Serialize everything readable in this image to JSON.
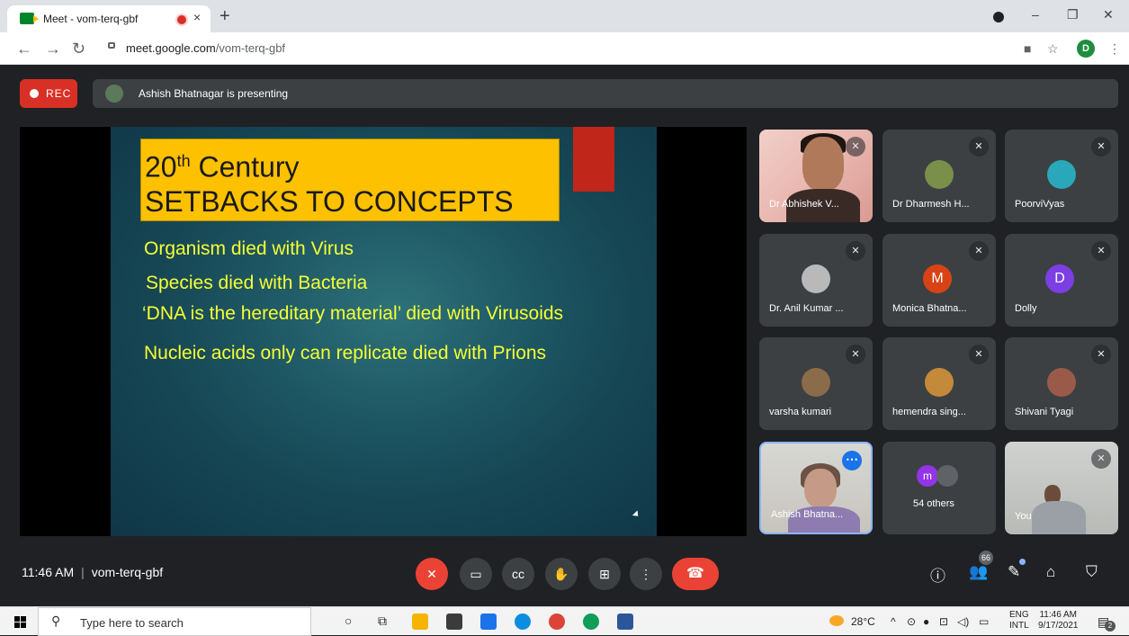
{
  "browser": {
    "tab_title": "Meet - vom-terq-gbf",
    "tab_close": "×",
    "new_tab": "+",
    "url_domain": "meet.google.com",
    "url_path": "/vom-terq-gbf",
    "profile_initial": "D",
    "window_controls": [
      "–",
      "❐",
      "✕"
    ]
  },
  "meet": {
    "rec_label": "REC",
    "presenting_text": "Ashish Bhatnagar is presenting",
    "meeting_time": "11:46 AM",
    "separator": "|",
    "meeting_code": "vom-terq-gbf",
    "participants_badge": "66"
  },
  "slide": {
    "title_prefix": "20",
    "title_sup": "th",
    "title_suffix": " Century",
    "title_line2": "SETBACKS TO CONCEPTS",
    "bullets": [
      "Organism died with Virus",
      "Species died with Bacteria",
      "‘DNA is the hereditary material’ died with Virusoids",
      "Nucleic acids only can replicate died with Prions"
    ]
  },
  "participants": [
    {
      "name": "Dr Abhishek V...",
      "kind": "video"
    },
    {
      "name": "Dr Dharmesh H...",
      "kind": "photo",
      "color": "#7a8f4a"
    },
    {
      "name": "PoorviVyas",
      "kind": "photo",
      "color": "#2aa7b8"
    },
    {
      "name": "Dr. Anil Kumar ...",
      "kind": "photo",
      "color": "#b9b9b9"
    },
    {
      "name": "Monica Bhatna...",
      "kind": "letter",
      "letter": "M",
      "color": "#d84315"
    },
    {
      "name": "Dolly",
      "kind": "letter",
      "letter": "D",
      "color": "#7b3fe4"
    },
    {
      "name": "varsha kumari",
      "kind": "photo",
      "color": "#8a6b4a"
    },
    {
      "name": "hemendra sing...",
      "kind": "photo",
      "color": "#c48a3a"
    },
    {
      "name": "Shivani Tyagi",
      "kind": "photo",
      "color": "#9a5a4a"
    },
    {
      "name": "Ashish Bhatna...",
      "kind": "video"
    },
    {
      "name": "54 others",
      "kind": "others",
      "letter": "m"
    },
    {
      "name": "You",
      "kind": "video"
    }
  ],
  "taskbar": {
    "search_placeholder": "Type here to search",
    "temperature": "28°C",
    "lang_line1": "ENG",
    "lang_line2": "INTL",
    "time": "11:46 AM",
    "date": "9/17/2021",
    "notification_count": "2"
  },
  "colors": {
    "rec_red": "#d93025",
    "end_call_red": "#ea4335",
    "slide_title_bg": "#fec100",
    "slide_text_yellow": "#f6ff33",
    "meet_bg": "#202124"
  }
}
